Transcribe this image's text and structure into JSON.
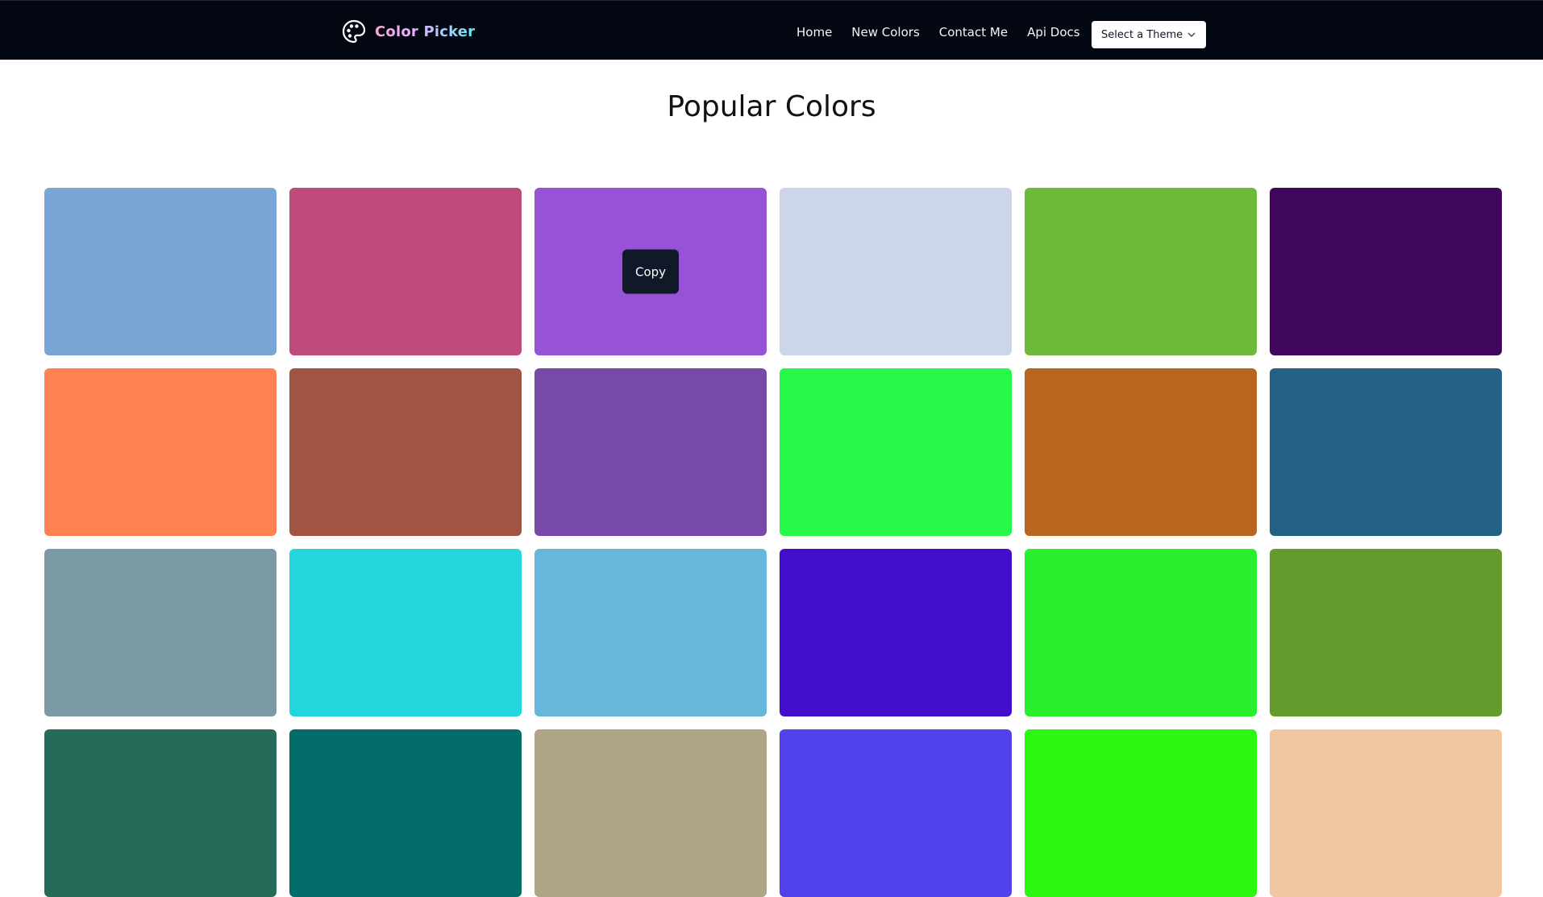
{
  "nav": {
    "brand": "Color Picker",
    "links": [
      "Home",
      "New Colors",
      "Contact Me",
      "Api Docs"
    ],
    "theme_select": "Select a Theme"
  },
  "page_title": "Popular Colors",
  "copy_label": "Copy",
  "hovered_index": 2,
  "colors": [
    "#7aa6d6",
    "#bd4a7b",
    "#9653d6",
    "#cdd5e8",
    "#6eba3b",
    "#40065c",
    "#ff8152",
    "#a15444",
    "#7749a8",
    "#26f948",
    "#b86520",
    "#246285",
    "#7c9aa3",
    "#22d6dc",
    "#69b6db",
    "#420fcc",
    "#29f02e",
    "#639b2d",
    "#256b59",
    "#036e69",
    "#b1a587",
    "#5043ec",
    "#2af712",
    "#f0c7a0"
  ]
}
